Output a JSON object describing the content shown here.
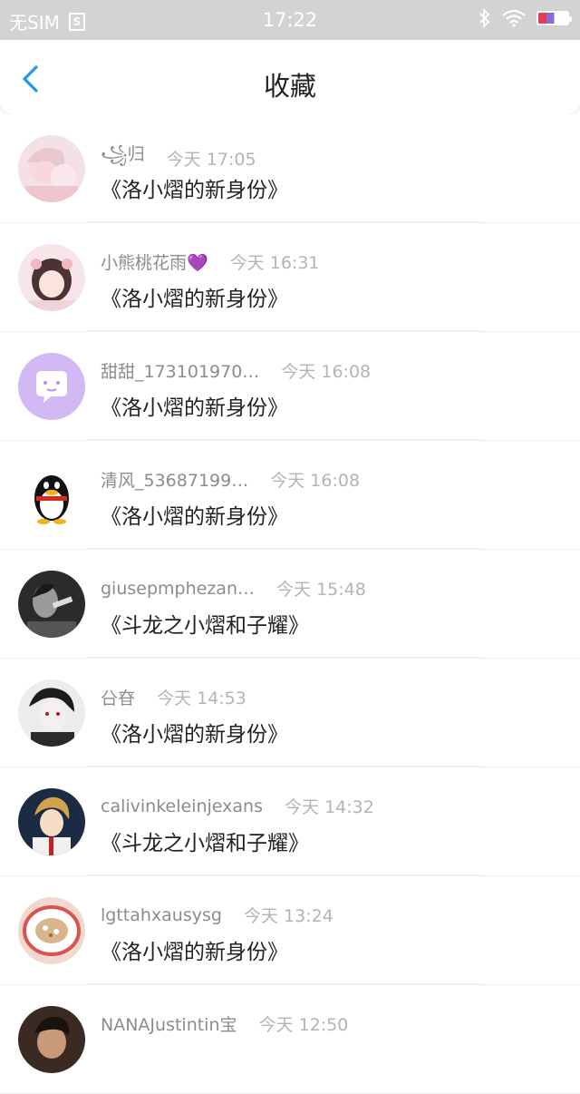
{
  "status_bar": {
    "carrier": "无SIM",
    "carrier_icon": "S",
    "time": "17:22",
    "icons": [
      "bluetooth-icon",
      "wifi-icon",
      "battery-icon"
    ]
  },
  "header": {
    "title": "收藏",
    "back_icon": "chevron-left-icon"
  },
  "accent_color": "#1a9bf0",
  "items": [
    {
      "user": "꧁归",
      "time": "今天 17:05",
      "message": "《洛小熠的新身份》",
      "avatar": "anime-pink"
    },
    {
      "user": "小熊桃花雨💜",
      "time": "今天 16:31",
      "message": "《洛小熠的新身份》",
      "avatar": "anime-girl"
    },
    {
      "user": "甜甜_173101970…",
      "time": "今天 16:08",
      "message": "《洛小熠的新身份》",
      "avatar": "chat-bubble"
    },
    {
      "user": "清风_53687199…",
      "time": "今天 16:08",
      "message": "《洛小熠的新身份》",
      "avatar": "qq-penguin"
    },
    {
      "user": "giusepmphezan…",
      "time": "今天 15:48",
      "message": "《斗龙之小熠和子耀》",
      "avatar": "bw-photo"
    },
    {
      "user": "㕣昚",
      "time": "今天 14:53",
      "message": "《洛小熠的新身份》",
      "avatar": "anime-boy-dark"
    },
    {
      "user": "calivinkeleinjexans",
      "time": "今天 14:32",
      "message": "《斗龙之小熠和子耀》",
      "avatar": "anime-boy-blonde"
    },
    {
      "user": "lgttahxausysg",
      "time": "今天 13:24",
      "message": "《洛小熠的新身份》",
      "avatar": "food-plate"
    },
    {
      "user": "NANAJustintin宝",
      "time": "今天 12:50",
      "message": "",
      "avatar": "dark-photo"
    }
  ]
}
